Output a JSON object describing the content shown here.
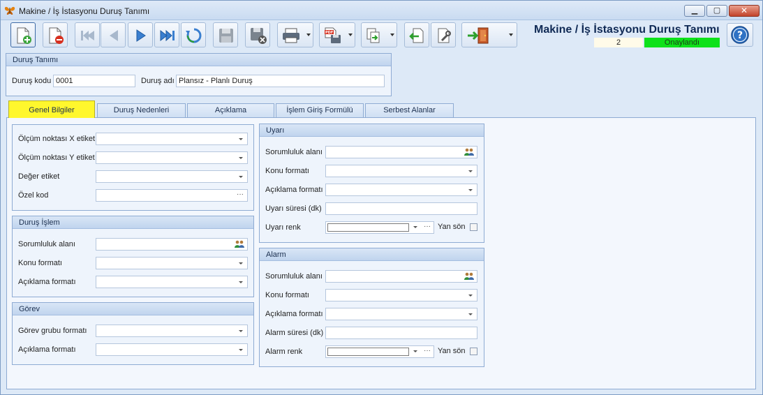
{
  "window": {
    "title": "Makine / İş İstasyonu Duruş Tanımı"
  },
  "header": {
    "title": "Makine / İş İstasyonu Duruş Tanımı",
    "count": "2",
    "status": "Onaylandı",
    "status_color": "#0ee11a"
  },
  "toolbar": {
    "icons": [
      "new-record-icon",
      "delete-record-icon",
      "first-record-icon",
      "prev-record-icon",
      "next-record-icon",
      "last-record-icon",
      "refresh-icon",
      "save-icon",
      "save-close-icon",
      "print-icon",
      "pdf-export-icon",
      "copy-icon",
      "import-icon",
      "settings-icon",
      "exit-icon",
      "help-icon"
    ]
  },
  "durus_tanimi": {
    "heading": "Duruş Tanımı",
    "kod_label": "Duruş kodu",
    "kod_value": "0001",
    "ad_label": "Duruş adı",
    "ad_value": "Plansız - Planlı Duruş"
  },
  "tabs": [
    {
      "label": "Genel Bilgiler",
      "selected": true
    },
    {
      "label": "Duruş Nedenleri",
      "selected": false
    },
    {
      "label": "Açıklama",
      "selected": false
    },
    {
      "label": "İşlem Giriş Formülü",
      "selected": false
    },
    {
      "label": "Serbest Alanlar",
      "selected": false
    }
  ],
  "general": {
    "olcum_x": "Ölçüm noktası X etiket",
    "olcum_y": "Ölçüm noktası Y etiket",
    "deger": "Değer etiket",
    "ozel_kod": "Özel kod"
  },
  "durus_islem": {
    "heading": "Duruş İşlem",
    "sorumluluk": "Sorumluluk alanı",
    "konu": "Konu formatı",
    "aciklama": "Açıklama formatı"
  },
  "gorev": {
    "heading": "Görev",
    "grubu": "Görev grubu formatı",
    "aciklama": "Açıklama formatı"
  },
  "uyari": {
    "heading": "Uyarı",
    "sorumluluk": "Sorumluluk alanı",
    "konu": "Konu formatı",
    "aciklama": "Açıklama formatı",
    "sure": "Uyarı süresi (dk)",
    "renk": "Uyarı renk",
    "yan_son": "Yan sön"
  },
  "alarm": {
    "heading": "Alarm",
    "sorumluluk": "Sorumluluk alanı",
    "konu": "Konu formatı",
    "aciklama": "Açıklama formatı",
    "sure": "Alarm süresi (dk)",
    "renk": "Alarm renk",
    "yan_son": "Yan sön"
  }
}
